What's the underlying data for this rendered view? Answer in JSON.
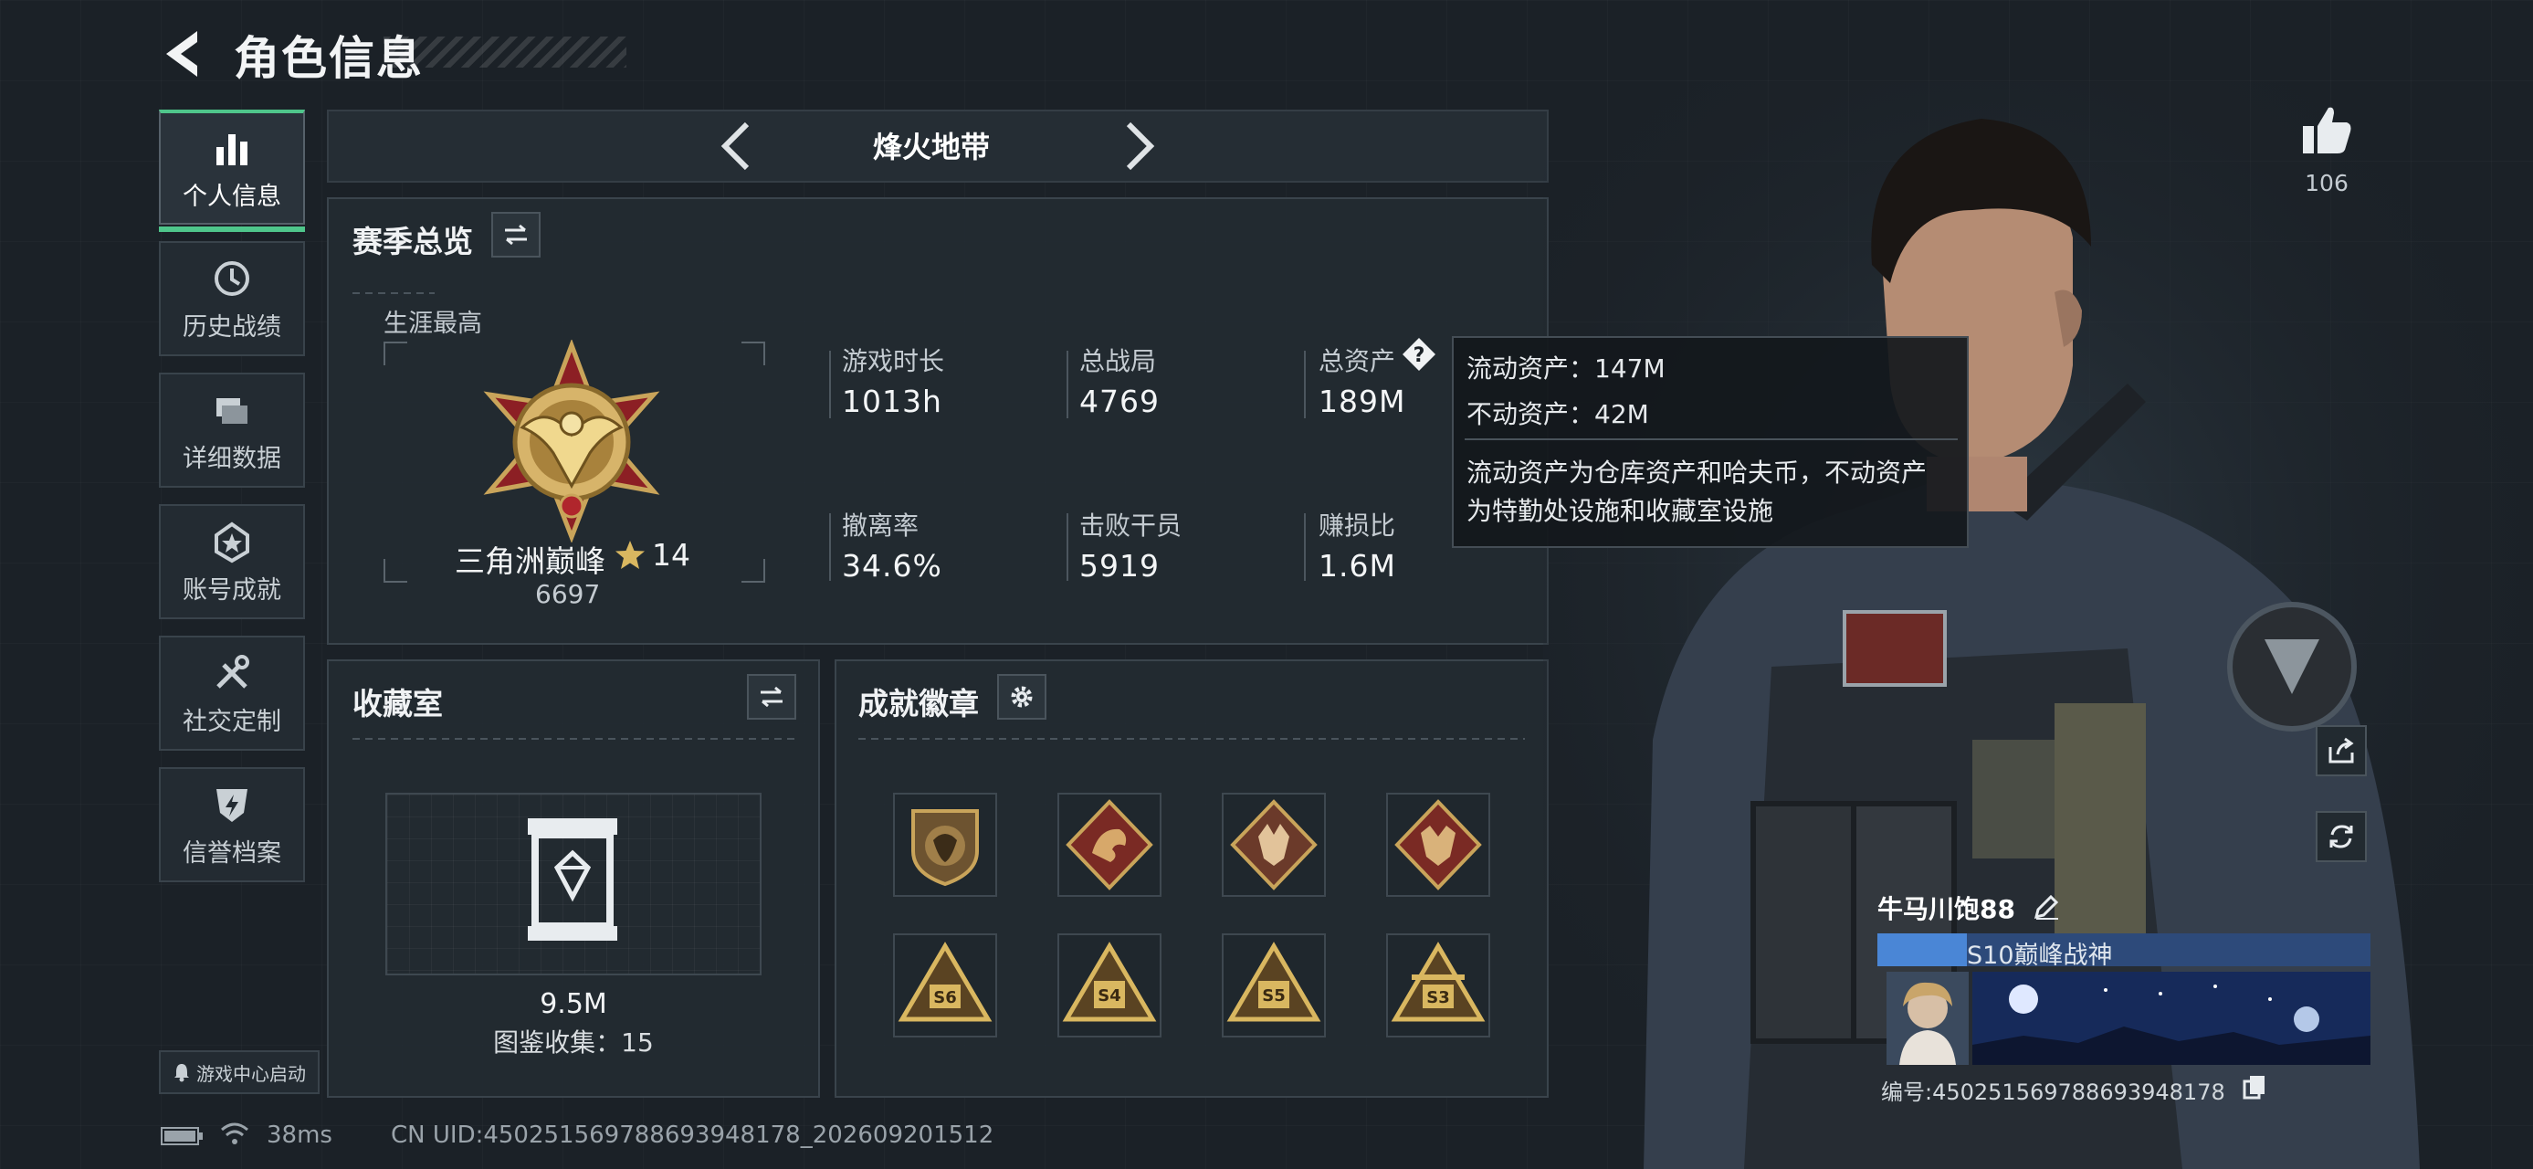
{
  "header": {
    "title": "角色信息"
  },
  "sidebar": {
    "items": [
      {
        "label": "个人信息",
        "icon": "bar-chart-icon",
        "active": true
      },
      {
        "label": "历史战绩",
        "icon": "clock-history-icon"
      },
      {
        "label": "详细数据",
        "icon": "folders-icon"
      },
      {
        "label": "账号成就",
        "icon": "achievement-icon"
      },
      {
        "label": "社交定制",
        "icon": "tools-icon"
      },
      {
        "label": "信誉档案",
        "icon": "shield-bolt-icon"
      }
    ],
    "game_center": "游戏中心启动"
  },
  "mode_bar": {
    "label": "烽火地带"
  },
  "season": {
    "title": "赛季总览",
    "career_label": "生涯最高",
    "rank_name": "三角洲巅峰",
    "rank_stars": "14",
    "rank_points": "6697",
    "stats": [
      {
        "label": "游戏时长",
        "value": "1013h"
      },
      {
        "label": "总战局",
        "value": "4769"
      },
      {
        "label": "总资产",
        "value": "189M"
      },
      {
        "label": "撤离率",
        "value": "34.6%"
      },
      {
        "label": "击败干员",
        "value": "5919"
      },
      {
        "label": "赚损比",
        "value": "1.6M"
      }
    ]
  },
  "tooltip": {
    "liquid": "流动资产：147M",
    "fixed": "不动资产：42M",
    "desc_line1": "流动资产为仓库资产和哈夫币，不动资产",
    "desc_line2": "为特勤处设施和收藏室设施"
  },
  "collection": {
    "title": "收藏室",
    "value": "9.5M",
    "catalog": "图鉴收集：15"
  },
  "badges": {
    "title": "成就徽章",
    "items": [
      {
        "icon": "lion-shield-badge-icon"
      },
      {
        "icon": "dragon-diamond-badge-icon"
      },
      {
        "icon": "wolf-diamond-badge-icon"
      },
      {
        "icon": "beast-diamond-badge-icon"
      },
      {
        "icon": "s6-triangle-badge-icon",
        "text": "S6"
      },
      {
        "icon": "s4-triangle-badge-icon",
        "text": "S4"
      },
      {
        "icon": "s5-triangle-badge-icon",
        "text": "S5"
      },
      {
        "icon": "s3-triangle-badge-icon",
        "text": "S3"
      }
    ]
  },
  "likes": {
    "count": "106"
  },
  "player": {
    "name": "牛马川饱88",
    "title": "S10巅峰战神",
    "id_label": "编号:450251569788693948178"
  },
  "footer": {
    "ping": "38ms",
    "uid": "CN UID:450251569788693948178_202609201512"
  },
  "colors": {
    "accent": "#4fc68b",
    "gold": "#c9a45a",
    "bg": "#1b2127",
    "name_bar": "#2d4a7a"
  }
}
